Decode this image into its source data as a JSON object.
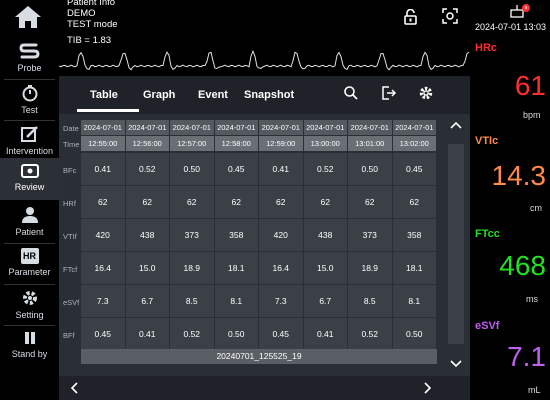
{
  "header": {
    "patient_info": "Patient Info",
    "patient_name": "DEMO",
    "mode": "TEST mode",
    "datetime": "2024-07-01 13:03"
  },
  "waveform": {
    "label": "TIB = 1.83"
  },
  "sidebar": {
    "items": [
      {
        "label": "Probe",
        "icon": "probe-icon"
      },
      {
        "label": "Test",
        "icon": "test-icon"
      },
      {
        "label": "Intervention",
        "icon": "intervention-icon"
      },
      {
        "label": "Review",
        "icon": "review-icon"
      },
      {
        "label": "Patient",
        "icon": "patient-icon"
      },
      {
        "label": "Parameter",
        "icon": "parameter-icon"
      },
      {
        "label": "Setting",
        "icon": "setting-icon"
      },
      {
        "label": "Stand by",
        "icon": "standby-icon"
      }
    ],
    "parameter_badge": "HR",
    "active": "Review"
  },
  "tabs": [
    {
      "label": "Table"
    },
    {
      "label": "Graph"
    },
    {
      "label": "Event"
    },
    {
      "label": "Snapshot"
    }
  ],
  "table": {
    "row_labels": [
      "Date",
      "Time",
      "BFc",
      "HRf",
      "VTIf",
      "FTcf",
      "eSVf",
      "BFf"
    ],
    "dates": [
      "2024-07-01",
      "2024-07-01",
      "2024-07-01",
      "2024-07-01",
      "2024-07-01",
      "2024-07-01",
      "2024-07-01",
      "2024-07-01"
    ],
    "times": [
      "12:55:00",
      "12:56:00",
      "12:57:00",
      "12:58:00",
      "12:59:00",
      "13:00:00",
      "13:01:00",
      "13:02:00"
    ],
    "rows": [
      [
        "0.41",
        "0.52",
        "0.50",
        "0.45",
        "0.41",
        "0.52",
        "0.50",
        "0.45"
      ],
      [
        "62",
        "62",
        "62",
        "62",
        "62",
        "62",
        "62",
        "62"
      ],
      [
        "420",
        "438",
        "373",
        "358",
        "420",
        "438",
        "373",
        "358"
      ],
      [
        "16.4",
        "15.0",
        "18.9",
        "18.1",
        "16.4",
        "15.0",
        "18.9",
        "18.1"
      ],
      [
        "7.3",
        "6.7",
        "8.5",
        "8.1",
        "7.3",
        "6.7",
        "8.5",
        "8.1"
      ],
      [
        "0.45",
        "0.41",
        "0.52",
        "0.50",
        "0.45",
        "0.41",
        "0.52",
        "0.50"
      ]
    ],
    "record_id": "20240701_125525_19"
  },
  "vitals": [
    {
      "label": "HRc",
      "value": "61",
      "unit": "bpm",
      "color": "#ff2e2e"
    },
    {
      "label": "VTIc",
      "value": "14.3",
      "unit": "cm",
      "color": "#ff8a4a"
    },
    {
      "label": "FTcc",
      "value": "468",
      "unit": "ms",
      "color": "#22e022"
    },
    {
      "label": "eSVf",
      "value": "7.1",
      "unit": "mL",
      "color": "#c060f0"
    }
  ]
}
